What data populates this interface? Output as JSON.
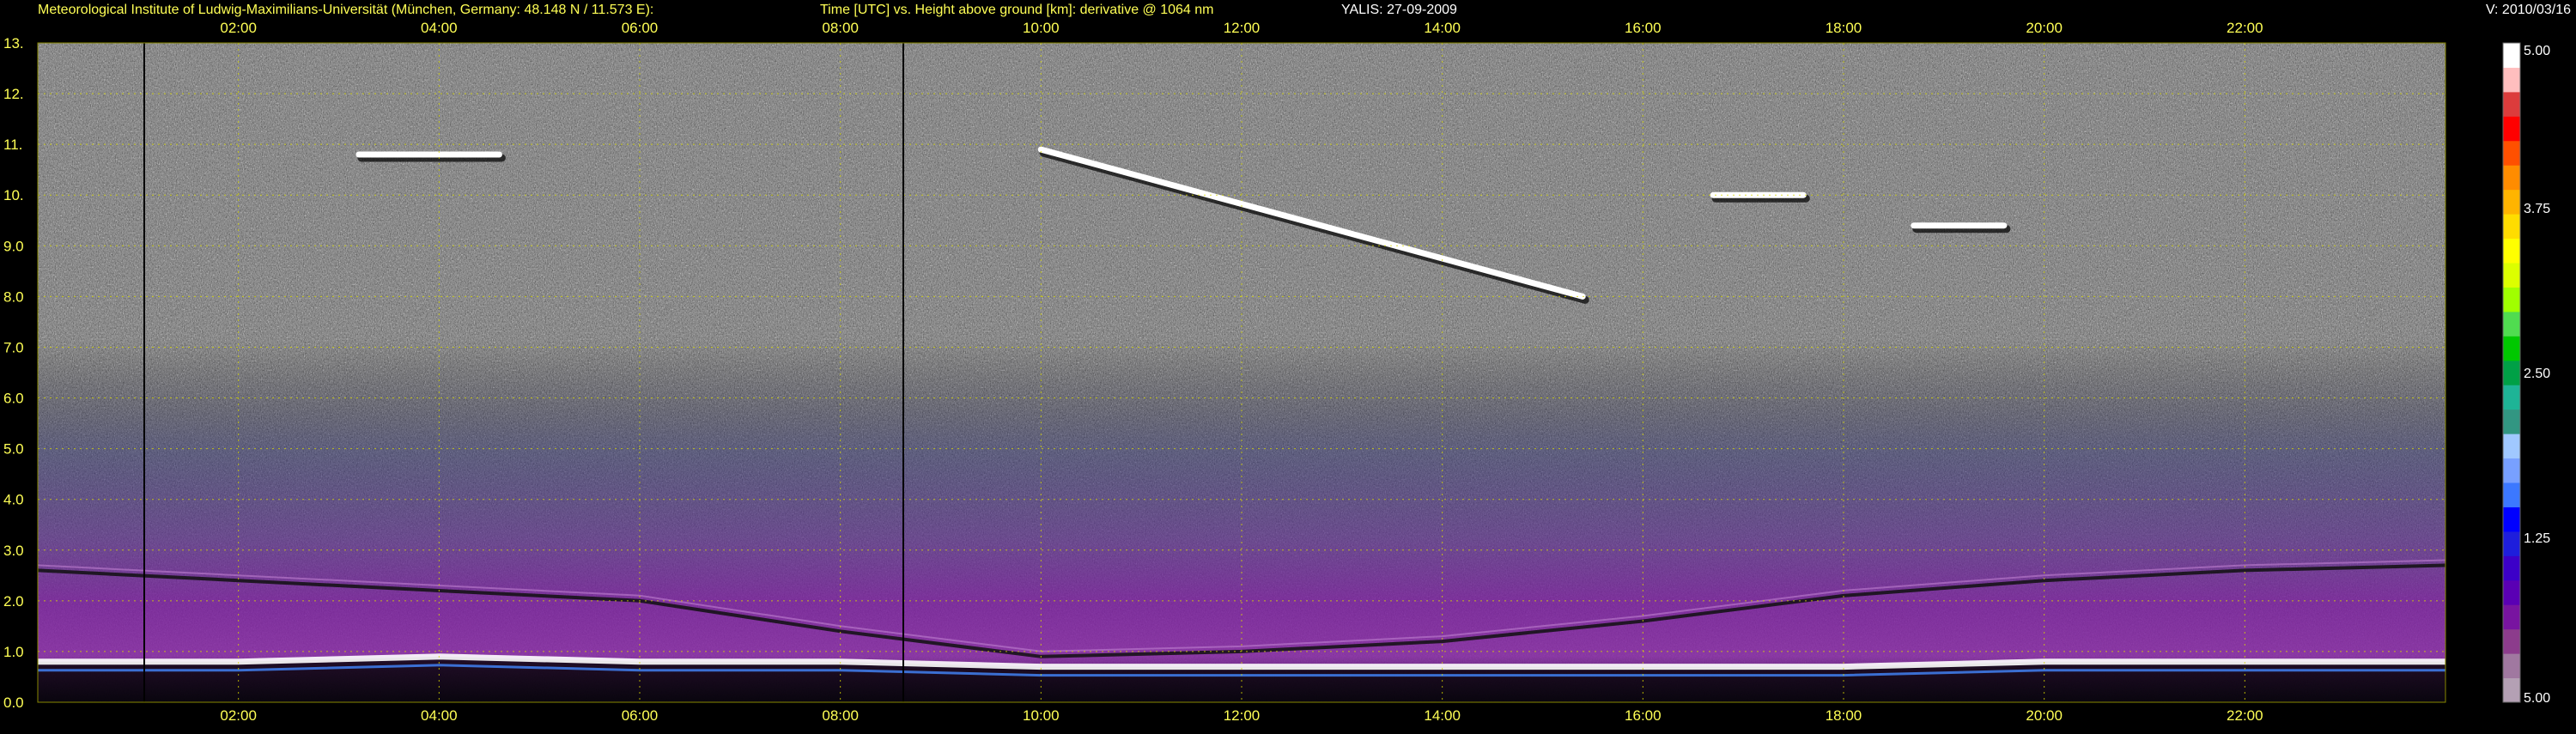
{
  "header": {
    "institute": "Meteorological Institute of Ludwig-Maximilians-Universität (München, Germany: 48.148 N / 11.573 E):",
    "axes_description": "Time [UTC] vs. Height above ground [km]: derivative @ 1064 nm",
    "instrument_date": "YALIS: 27-09-2009",
    "version": "V: 2010/03/16"
  },
  "colors": {
    "text": "#ffff55",
    "grid": "#d8d800",
    "background": "#000000",
    "noise_light": "#d9d9d9",
    "purple": "#8a2aa8",
    "blue": "#4444cc"
  },
  "chart_data": {
    "type": "heatmap",
    "title": "Time [UTC] vs. Height above ground [km]: derivative @ 1064 nm",
    "xlabel": "Time [UTC]",
    "ylabel": "Height above ground [km]",
    "x_ticks": [
      "02:00",
      "04:00",
      "06:00",
      "08:00",
      "10:00",
      "12:00",
      "14:00",
      "16:00",
      "18:00",
      "20:00",
      "22:00"
    ],
    "x_tick_hours": [
      2,
      4,
      6,
      8,
      10,
      12,
      14,
      16,
      18,
      20,
      22
    ],
    "xlim_hours": [
      0.0,
      24.0
    ],
    "y_ticks": [
      "0.0",
      "1.0",
      "2.0",
      "3.0",
      "4.0",
      "5.0",
      "6.0",
      "7.0",
      "8.0",
      "9.0",
      "10.",
      "11.",
      "12.",
      "13."
    ],
    "y_tick_values": [
      0,
      1,
      2,
      3,
      4,
      5,
      6,
      7,
      8,
      9,
      10,
      11,
      12,
      13
    ],
    "ylim_km": [
      0,
      13
    ],
    "grid": true,
    "colorbar": {
      "tick_labels": [
        "5.00",
        "1.25",
        "2.50",
        "3.75",
        "5.00"
      ],
      "colors": [
        "#b4a0b4",
        "#a078a0",
        "#8c3c8c",
        "#7814a0",
        "#5a00b4",
        "#3c00c8",
        "#1e1edc",
        "#0000ff",
        "#3c78ff",
        "#78a0ff",
        "#a0c8ff",
        "#329682",
        "#1eb496",
        "#00a046",
        "#00c800",
        "#50dc50",
        "#a0ff00",
        "#dcff00",
        "#ffff00",
        "#ffdc00",
        "#ffb400",
        "#ff8c00",
        "#ff5000",
        "#ff0000",
        "#dc3c3c",
        "#ffbebe",
        "#ffffff"
      ]
    },
    "features": [
      {
        "kind": "boundary_layer_top",
        "height_km": [
          0.8,
          0.8,
          0.9,
          0.8,
          0.8,
          0.7,
          0.7,
          0.7,
          0.7,
          0.7,
          0.8,
          0.8,
          0.8
        ],
        "hours": [
          0,
          2,
          4,
          6,
          8,
          10,
          12,
          14,
          16,
          18,
          20,
          22,
          24
        ]
      },
      {
        "kind": "aerosol_layer",
        "height_km": [
          2.6,
          2.4,
          2.2,
          2.0,
          1.4,
          0.9,
          1.0,
          1.2,
          1.6,
          2.1,
          2.4,
          2.6,
          2.7
        ],
        "hours": [
          0,
          2,
          4,
          6,
          8,
          10,
          12,
          14,
          16,
          18,
          20,
          22,
          24
        ]
      },
      {
        "kind": "cirrus",
        "start_hour": 3.2,
        "end_hour": 4.6,
        "height_km": 10.8
      },
      {
        "kind": "cirrus",
        "start_hour": 10.0,
        "end_hour": 15.4,
        "height_km_start": 10.9,
        "height_km_end": 8.0
      },
      {
        "kind": "cirrus",
        "start_hour": 16.7,
        "end_hour": 17.6,
        "height_km": 10.0
      },
      {
        "kind": "cirrus",
        "start_hour": 18.7,
        "end_hour": 19.6,
        "height_km": 9.4
      }
    ]
  }
}
